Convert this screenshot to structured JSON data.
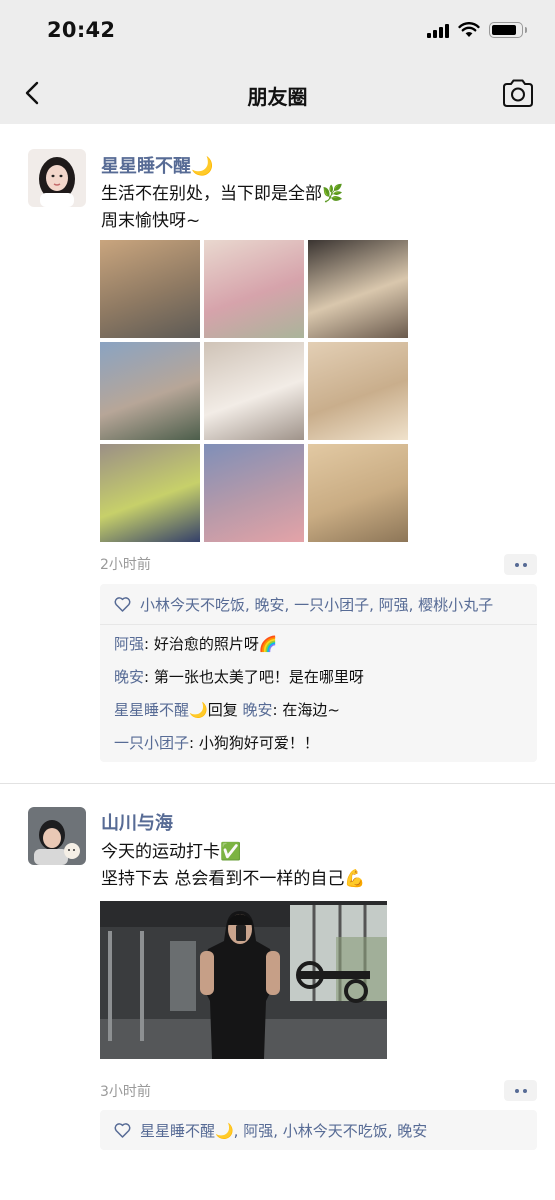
{
  "status": {
    "time": "20:42",
    "battery_level": 0.85
  },
  "nav": {
    "title": "朋友圈",
    "back_icon": "chevron-left-icon",
    "camera_icon": "camera-icon"
  },
  "posts": [
    {
      "author": "星星睡不醒🌙",
      "lines": [
        "生活不在别处，当下即是全部🌿",
        "周末愉快呀~"
      ],
      "images": [
        {
          "name": "sunset-photo",
          "colors": [
            "#c9a57e",
            "#8f7a63",
            "#5d5a55"
          ]
        },
        {
          "name": "tulips-photo",
          "colors": [
            "#e9d8cf",
            "#d6a3ab",
            "#aab49a"
          ]
        },
        {
          "name": "cake-photo",
          "colors": [
            "#3a3431",
            "#d9c7ad",
            "#6a5a4d"
          ]
        },
        {
          "name": "street-photo",
          "colors": [
            "#8aa3c2",
            "#b7a698",
            "#4c5e4b"
          ]
        },
        {
          "name": "dog-photo",
          "colors": [
            "#cfc3b7",
            "#f2ece6",
            "#9f938a"
          ]
        },
        {
          "name": "candle-photo",
          "colors": [
            "#e3cfb5",
            "#c9ae8c",
            "#f0e2cc"
          ]
        },
        {
          "name": "grapes-photo",
          "colors": [
            "#9b8f86",
            "#c7d06a",
            "#34406a"
          ]
        },
        {
          "name": "sky-photo",
          "colors": [
            "#7f8fb8",
            "#b89aa9",
            "#e4a3a8"
          ]
        },
        {
          "name": "shadow-photo",
          "colors": [
            "#e2c9a3",
            "#c9ac83",
            "#8d7658"
          ]
        }
      ],
      "time_ago": "2小时前",
      "likes": "小林今天不吃饭, 晚安, 一只小团子, 阿强, 樱桃小丸子",
      "comments": [
        {
          "name": "阿强",
          "reply_to": "",
          "text": "好治愈的照片呀🌈"
        },
        {
          "name": "晚安",
          "reply_to": "",
          "text": "第一张也太美了吧！是在哪里呀"
        },
        {
          "name": "星星睡不醒🌙",
          "reply_word": "回复",
          "reply_to": "晚安",
          "text": "在海边~"
        },
        {
          "name": "一只小团子",
          "reply_to": "",
          "text": "小狗狗好可爱！！"
        }
      ]
    },
    {
      "author": "山川与海",
      "lines": [
        "今天的运动打卡✅",
        "坚持下去 总会看到不一样的自己💪"
      ],
      "images": [
        {
          "name": "gym-selfie-photo",
          "colors": [
            "#2f3133",
            "#6f7679",
            "#bfc6c3"
          ]
        }
      ],
      "time_ago": "3小时前",
      "likes": "星星睡不醒🌙, 阿强, 小林今天不吃饭, 晚安",
      "comments": []
    }
  ],
  "colors": {
    "link": "#576b95",
    "background": "#ededed",
    "card": "#ffffff",
    "interaction_bg": "#f6f6f6"
  }
}
